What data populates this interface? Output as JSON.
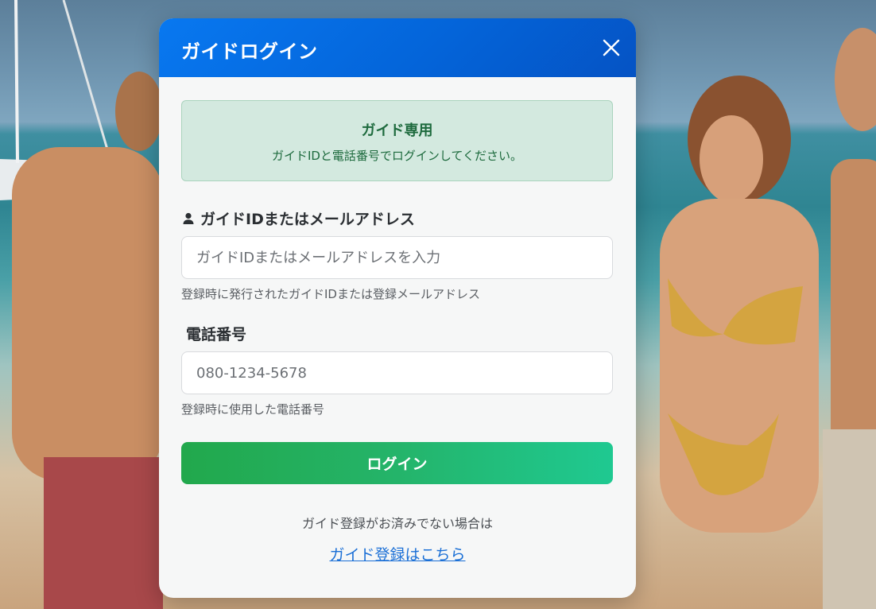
{
  "modal": {
    "title": "ガイドログイン",
    "close_icon": "close-icon"
  },
  "notice": {
    "title": "ガイド専用",
    "text": "ガイドIDと電話番号でログインしてください。"
  },
  "guide_id": {
    "label": "ガイドIDまたはメールアドレス",
    "icon": "user-icon",
    "placeholder": "ガイドIDまたはメールアドレスを入力",
    "help": "登録時に発行されたガイドIDまたは登録メールアドレス"
  },
  "phone": {
    "label": "電話番号",
    "placeholder": "080-1234-5678",
    "help": "登録時に使用した電話番号"
  },
  "login_button": {
    "label": "ログイン"
  },
  "footer": {
    "prompt": "ガイド登録がお済みでない場合は",
    "register_link": "ガイド登録はこちら"
  },
  "colors": {
    "header": "#0465da",
    "notice_bg": "#d3e9df",
    "notice_text": "#1d6a3d",
    "button_start": "#22a84c",
    "button_end": "#1fc991",
    "link": "#1a6fd6"
  }
}
